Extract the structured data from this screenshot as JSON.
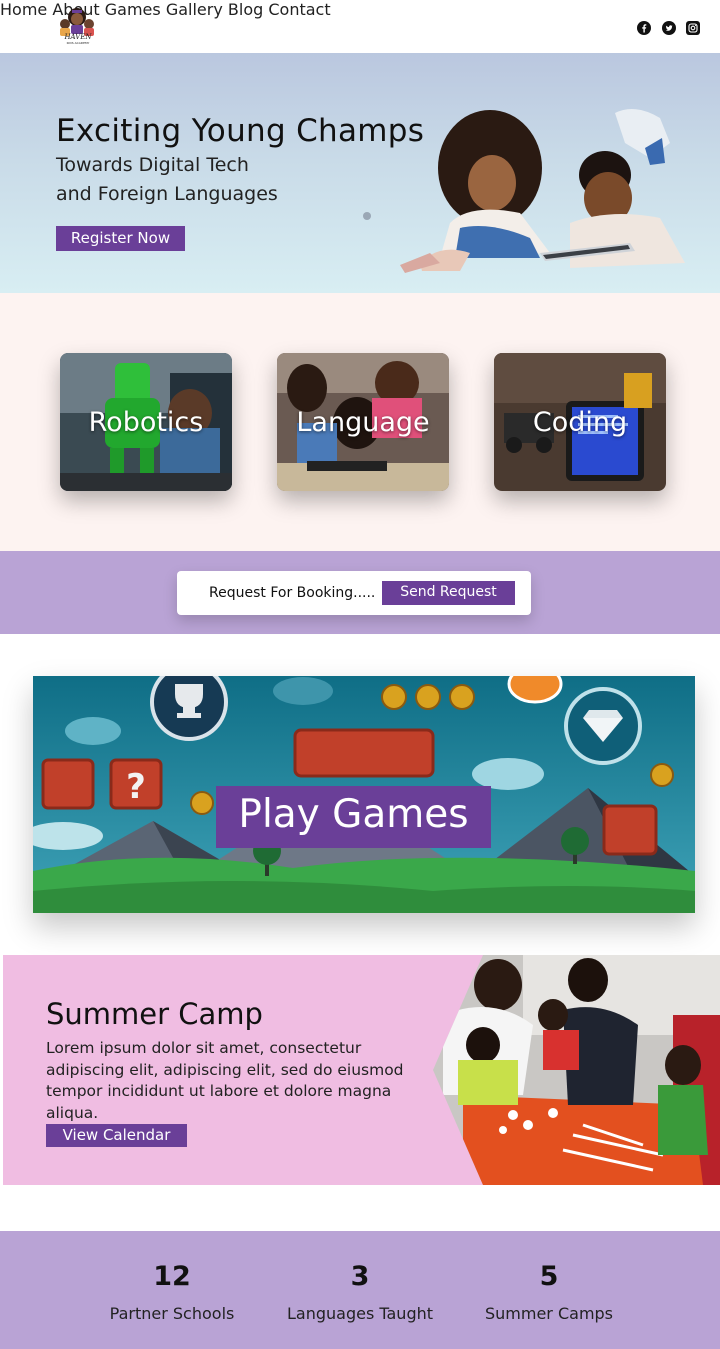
{
  "brand": {
    "logo_text": "HAVEN",
    "logo_subtext": "KIDS ACADEMY"
  },
  "nav": {
    "items": [
      "Home",
      "About",
      "Games",
      "Gallery",
      "Blog",
      "Contact"
    ]
  },
  "social": [
    "facebook-icon",
    "twitter-icon",
    "instagram-icon"
  ],
  "hero": {
    "title": "Exciting Young Champs",
    "subtitle_line1": "Towards Digital Tech",
    "subtitle_line2": "and Foreign Languages",
    "cta_label": "Register Now"
  },
  "categories": [
    {
      "label": "Robotics"
    },
    {
      "label": "Language"
    },
    {
      "label": "Coding"
    }
  ],
  "booking": {
    "text": "Request For Booking.....",
    "button_label": "Send Request"
  },
  "games": {
    "label": "Play Games"
  },
  "camp": {
    "title": "Summer Camp",
    "text": "Lorem ipsum dolor sit amet, consectetur adipiscing elit, adipiscing elit, sed do eiusmod tempor incididunt ut labore et dolore magna aliqua.",
    "button_label": "View Calendar"
  },
  "stats": [
    {
      "number": "12",
      "label": "Partner Schools"
    },
    {
      "number": "3",
      "label": "Languages Taught"
    },
    {
      "number": "5",
      "label": "Summer Camps"
    }
  ],
  "colors": {
    "accent": "#6a3f98",
    "lavender": "#b9a3d5",
    "pink": "#f0bde2",
    "cream": "#fdf3f1"
  }
}
